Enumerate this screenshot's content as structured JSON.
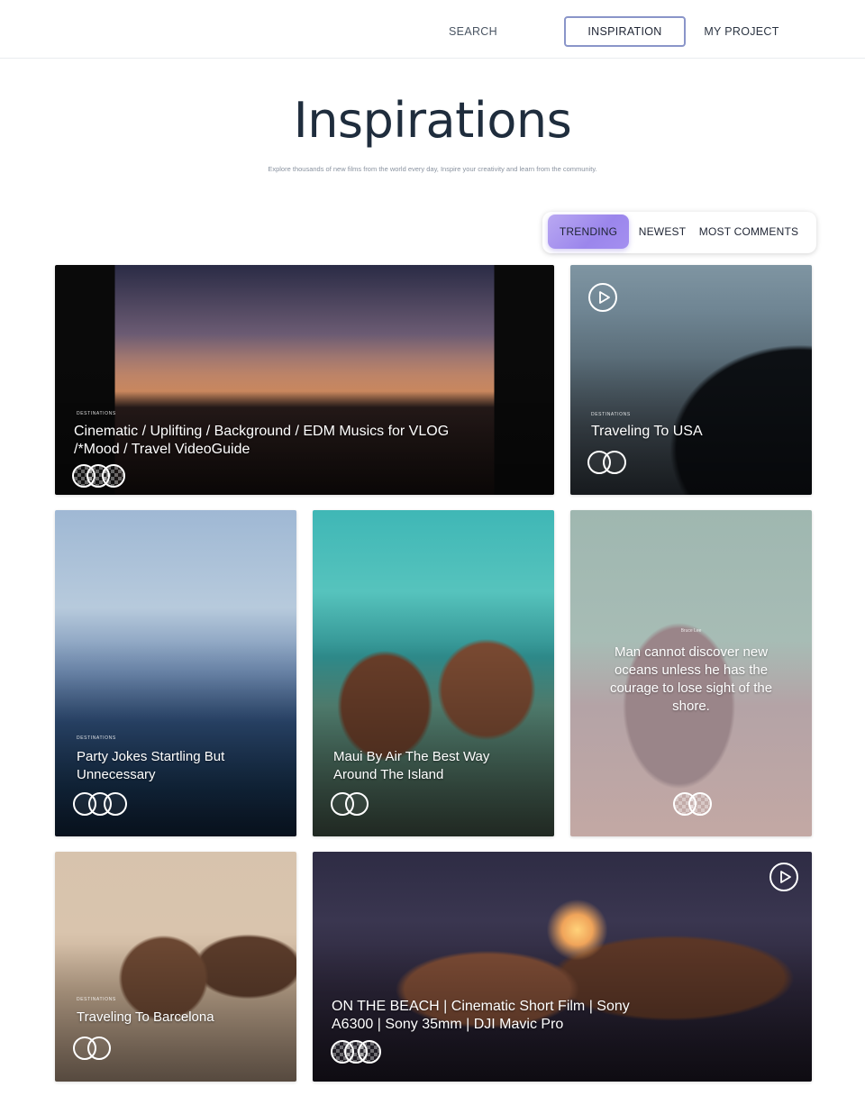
{
  "nav": {
    "search": "SEARCH",
    "inspiration": "INSPIRATION",
    "my_project": "MY PROJECT"
  },
  "hero": {
    "title": "Inspirations",
    "subtitle": "Explore thousands of new films from the world every day, Inspire your creativity and learn from the community."
  },
  "filters": {
    "trending": "TRENDING",
    "newest": "NEWEST",
    "most_comments": "MOST COMMENTS",
    "active": "TRENDING"
  },
  "cards": [
    {
      "tag": "DESTINATIONS",
      "title": "Cinematic / Uplifting / Background / EDM Musics for VLOG /*Mood / Travel VideoGuide"
    },
    {
      "tag": "DESTINATIONS",
      "title": "Traveling To USA"
    },
    {
      "tag": "DESTINATIONS",
      "title": "Party Jokes Startling But Unnecessary"
    },
    {
      "tag": "",
      "title": "Maui By Air The Best Way Around The Island"
    },
    {
      "tag": "Bruce Lee",
      "title": "Man cannot discover new oceans unless he has the courage to lose sight of the shore."
    },
    {
      "tag": "DESTINATIONS",
      "title": "Traveling To Barcelona"
    },
    {
      "tag": "",
      "title": "ON THE BEACH | Cinematic Short Film | Sony A6300 | Sony 35mm | DJI Mavic Pro"
    }
  ],
  "colors": {
    "accent": "#9b86ec",
    "nav_active_border": "#8a95c9",
    "title": "#1f2d3d"
  },
  "icons": {
    "play": "play-icon",
    "avatar": "avatar"
  }
}
